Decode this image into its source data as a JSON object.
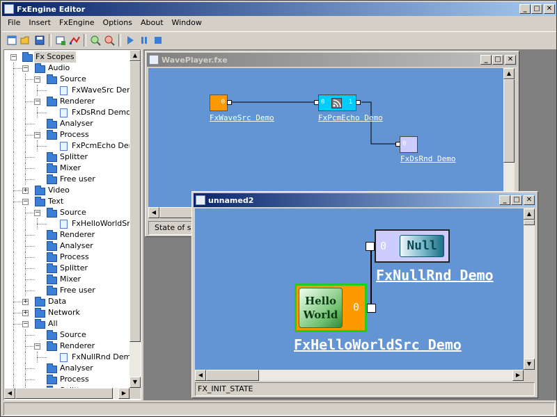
{
  "app": {
    "title": "FxEngine Editor"
  },
  "menu": {
    "items": [
      "File",
      "Insert",
      "FxEngine",
      "Options",
      "About",
      "Window"
    ]
  },
  "toolbar": {
    "buttons": [
      "new-icon",
      "open-icon",
      "save-icon",
      "add-filter-icon",
      "connect-icon",
      "zoom-in-icon",
      "remove-icon",
      "play-icon",
      "pause-icon",
      "stop-icon"
    ]
  },
  "tree": {
    "root": "Fx Scopes",
    "nodes": [
      "Audio",
      "Source",
      "FxWaveSrc Demo",
      "Renderer",
      "FxDsRnd Demo",
      "Analyser",
      "Process",
      "FxPcmEcho Demo",
      "Splitter",
      "Mixer",
      "Free user",
      "Video",
      "Text",
      "Source",
      "FxHelloWorldSrc",
      "Renderer",
      "Analyser",
      "Process",
      "Splitter",
      "Mixer",
      "Free user",
      "Data",
      "Network",
      "All",
      "Source",
      "Renderer",
      "FxNullRnd Demo",
      "Analyser",
      "Process",
      "Splitter"
    ]
  },
  "wave_window": {
    "title": "WavePlayer.fxe",
    "status": "State of se",
    "nodes": {
      "wavesrc": {
        "label": "FxWaveSrc Demo",
        "pin_out": "0",
        "color": "#ff9900"
      },
      "pcmecho": {
        "label": "FxPcmEcho Demo",
        "pin_in": "0",
        "pin_out": "1",
        "color": "#00ccff"
      },
      "dsrnd": {
        "label": "FxDsRnd Demo",
        "pin_in": "0",
        "color": "#ccccff"
      }
    }
  },
  "unnamed_window": {
    "title": "unnamed2",
    "status": "FX_INIT_STATE",
    "nodes": {
      "nullrnd": {
        "label": "FxNullRnd Demo",
        "pin_in": "0",
        "badge": "Null"
      },
      "helloworld": {
        "label": "FxHelloWorldSrc Demo",
        "pin_out": "0",
        "badge_line1": "Hello",
        "badge_line2": "World"
      }
    }
  },
  "colors": {
    "canvas": "#6395d4",
    "titlebar_active": "#0a246a",
    "highlight_green": "#22cc22"
  }
}
